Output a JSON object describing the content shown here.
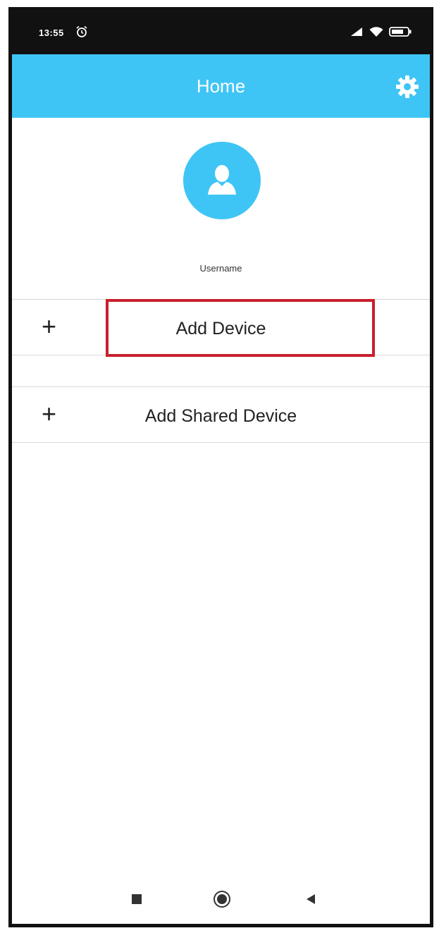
{
  "status_bar": {
    "time": "13:55",
    "icons": [
      "alarm-icon",
      "signal-icon",
      "wifi-icon",
      "battery-icon"
    ]
  },
  "app_bar": {
    "title": "Home",
    "settings_icon": "gear-icon",
    "color": "#3fc5f5"
  },
  "profile": {
    "avatar_icon": "user-icon",
    "username": "Username"
  },
  "menu": {
    "items": [
      {
        "icon": "plus-icon",
        "plus": "+",
        "label": "Add Device"
      },
      {
        "icon": "plus-icon",
        "plus": "+",
        "label": "Add Shared Device"
      }
    ],
    "highlight_color": "#c8202e"
  },
  "nav_bar": {
    "buttons": [
      "recents-square-icon",
      "home-circle-icon",
      "back-triangle-icon"
    ]
  }
}
